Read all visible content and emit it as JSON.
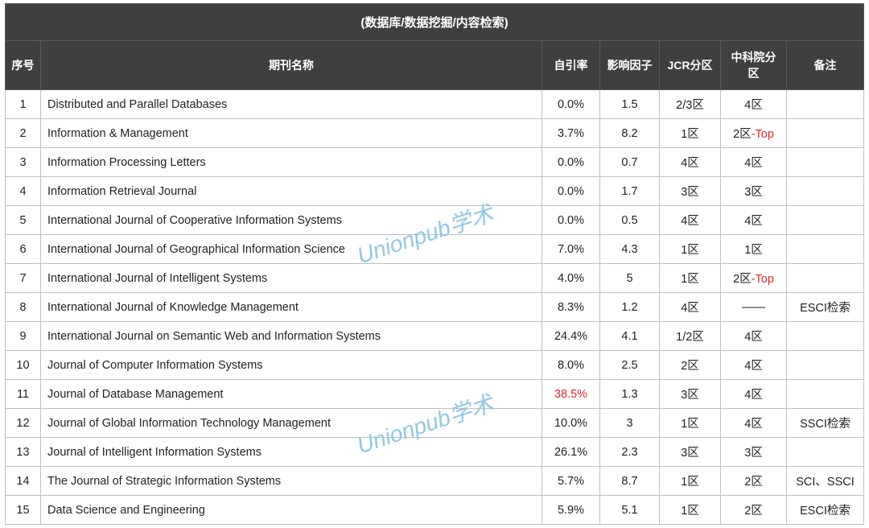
{
  "title": "(数据库/数据挖掘/内容检索)",
  "headers": {
    "idx": "序号",
    "name": "期刊名称",
    "self": "自引率",
    "if": "影响因子",
    "jcr": "JCR分区",
    "cas": "中科院分区",
    "note": "备注"
  },
  "watermark": "Unionpub学术",
  "top_suffix": "-Top",
  "rows": [
    {
      "idx": "1",
      "name": "Distributed and Parallel Databases",
      "self": "0.0%",
      "if": "1.5",
      "jcr": "2/3区",
      "cas": "4区",
      "note": ""
    },
    {
      "idx": "2",
      "name": "Information & Management",
      "self": "3.7%",
      "if": "8.2",
      "jcr": "1区",
      "cas": "2区",
      "cas_top": true,
      "note": ""
    },
    {
      "idx": "3",
      "name": "Information Processing Letters",
      "self": "0.0%",
      "if": "0.7",
      "jcr": "4区",
      "cas": "4区",
      "note": ""
    },
    {
      "idx": "4",
      "name": "Information Retrieval Journal",
      "self": "0.0%",
      "if": "1.7",
      "jcr": "3区",
      "cas": "3区",
      "note": ""
    },
    {
      "idx": "5",
      "name": "International Journal of Cooperative Information Systems",
      "self": "0.0%",
      "if": "0.5",
      "jcr": "4区",
      "cas": "4区",
      "note": ""
    },
    {
      "idx": "6",
      "name": "International Journal of Geographical Information Science",
      "self": "7.0%",
      "if": "4.3",
      "jcr": "1区",
      "cas": "1区",
      "note": ""
    },
    {
      "idx": "7",
      "name": "International Journal of Intelligent Systems",
      "self": "4.0%",
      "if": "5",
      "jcr": "1区",
      "cas": "2区",
      "cas_top": true,
      "note": ""
    },
    {
      "idx": "8",
      "name": "International Journal of Knowledge Management",
      "self": "8.3%",
      "if": "1.2",
      "jcr": "4区",
      "cas": "——",
      "note": "ESCI检索"
    },
    {
      "idx": "9",
      "name": "International Journal on Semantic Web and Information Systems",
      "self": "24.4%",
      "if": "4.1",
      "jcr": "1/2区",
      "cas": "4区",
      "note": ""
    },
    {
      "idx": "10",
      "name": "Journal of Computer Information Systems",
      "self": "8.0%",
      "if": "2.5",
      "jcr": "2区",
      "cas": "4区",
      "note": ""
    },
    {
      "idx": "11",
      "name": "Journal of Database Management",
      "self": "38.5%",
      "self_red": true,
      "if": "1.3",
      "jcr": "3区",
      "cas": "4区",
      "note": ""
    },
    {
      "idx": "12",
      "name": "Journal of Global Information Technology Management",
      "self": "10.0%",
      "if": "3",
      "jcr": "1区",
      "cas": "4区",
      "note": "SSCI检索"
    },
    {
      "idx": "13",
      "name": "Journal of Intelligent Information Systems",
      "self": "26.1%",
      "if": "2.3",
      "jcr": "3区",
      "cas": "3区",
      "note": ""
    },
    {
      "idx": "14",
      "name": "The Journal of Strategic Information Systems",
      "self": "5.7%",
      "if": "8.7",
      "jcr": "1区",
      "cas": "2区",
      "note": "SCI、SSCI"
    },
    {
      "idx": "15",
      "name": "Data Science and Engineering",
      "self": "5.9%",
      "if": "5.1",
      "jcr": "1区",
      "cas": "2区",
      "note": "ESCI检索"
    }
  ],
  "chart_data": {
    "type": "table",
    "title": "(数据库/数据挖掘/内容检索)",
    "columns": [
      "序号",
      "期刊名称",
      "自引率",
      "影响因子",
      "JCR分区",
      "中科院分区",
      "备注"
    ],
    "rows": [
      [
        "1",
        "Distributed and Parallel Databases",
        "0.0%",
        "1.5",
        "2/3区",
        "4区",
        ""
      ],
      [
        "2",
        "Information & Management",
        "3.7%",
        "8.2",
        "1区",
        "2区-Top",
        ""
      ],
      [
        "3",
        "Information Processing Letters",
        "0.0%",
        "0.7",
        "4区",
        "4区",
        ""
      ],
      [
        "4",
        "Information Retrieval Journal",
        "0.0%",
        "1.7",
        "3区",
        "3区",
        ""
      ],
      [
        "5",
        "International Journal of Cooperative Information Systems",
        "0.0%",
        "0.5",
        "4区",
        "4区",
        ""
      ],
      [
        "6",
        "International Journal of Geographical Information Science",
        "7.0%",
        "4.3",
        "1区",
        "1区",
        ""
      ],
      [
        "7",
        "International Journal of Intelligent Systems",
        "4.0%",
        "5",
        "1区",
        "2区-Top",
        ""
      ],
      [
        "8",
        "International Journal of Knowledge Management",
        "8.3%",
        "1.2",
        "4区",
        "——",
        "ESCI检索"
      ],
      [
        "9",
        "International Journal on Semantic Web and Information Systems",
        "24.4%",
        "4.1",
        "1/2区",
        "4区",
        ""
      ],
      [
        "10",
        "Journal of Computer Information Systems",
        "8.0%",
        "2.5",
        "2区",
        "4区",
        ""
      ],
      [
        "11",
        "Journal of Database Management",
        "38.5%",
        "1.3",
        "3区",
        "4区",
        ""
      ],
      [
        "12",
        "Journal of Global Information Technology Management",
        "10.0%",
        "3",
        "1区",
        "4区",
        "SSCI检索"
      ],
      [
        "13",
        "Journal of Intelligent Information Systems",
        "26.1%",
        "2.3",
        "3区",
        "3区",
        ""
      ],
      [
        "14",
        "The Journal of Strategic Information Systems",
        "5.7%",
        "8.7",
        "1区",
        "2区",
        "SCI、SSCI"
      ],
      [
        "15",
        "Data Science and Engineering",
        "5.9%",
        "5.1",
        "1区",
        "2区",
        "ESCI检索"
      ]
    ]
  }
}
